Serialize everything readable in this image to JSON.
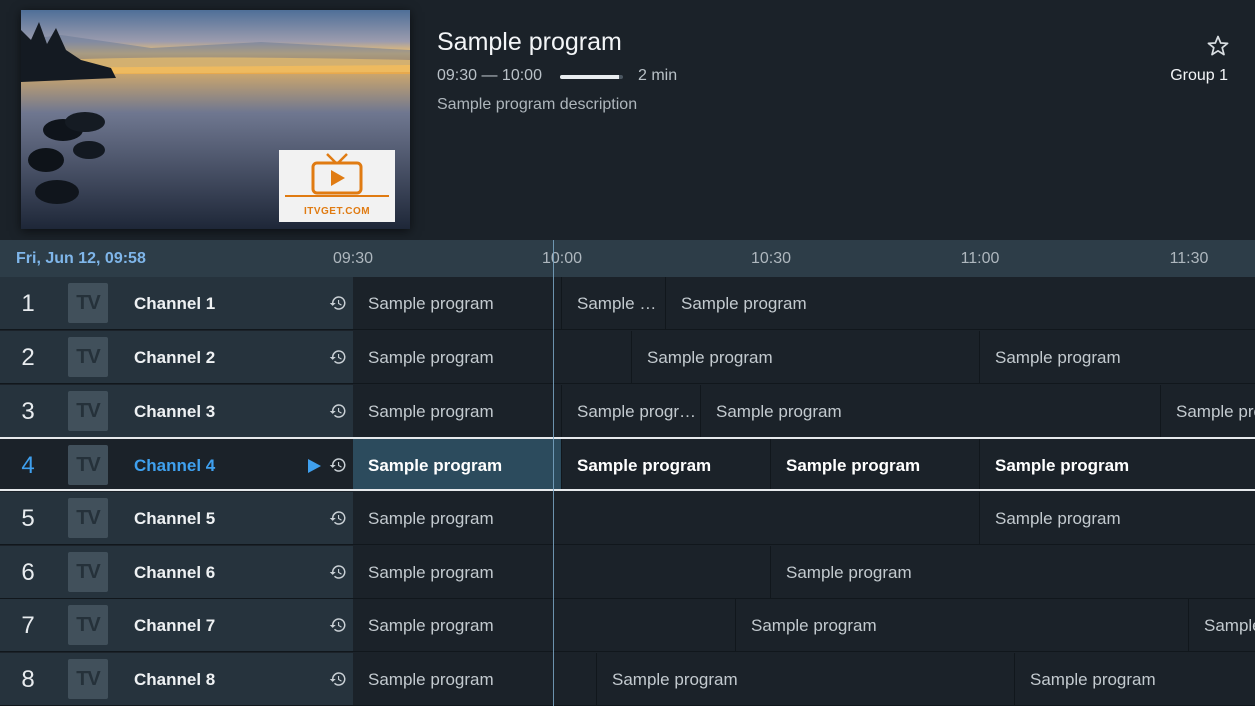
{
  "preview": {
    "logo_text": "ITVGET.COM",
    "logo_color": "#e07b12"
  },
  "program": {
    "title": "Sample program",
    "time": "09:30 — 10:00",
    "progress_fraction": 0.93,
    "remaining": "2 min",
    "description": "Sample program description"
  },
  "header": {
    "favorite_icon": "star-outline-icon",
    "group": "Group 1"
  },
  "timeline": {
    "current": "Fri, Jun 12, 09:58",
    "ticks": [
      "09:30",
      "10:00",
      "10:30",
      "11:00",
      "11:30"
    ]
  },
  "colors": {
    "accent": "#3fa0ee",
    "date": "#7fb6ea"
  },
  "channels": [
    {
      "number": "1",
      "logo": "TV",
      "name": "Channel 1",
      "programs": [
        "Sample program",
        "Sample …",
        "Sample program"
      ]
    },
    {
      "number": "2",
      "logo": "TV",
      "name": "Channel 2",
      "programs": [
        "Sample program",
        "Sample program",
        "Sample program"
      ]
    },
    {
      "number": "3",
      "logo": "TV",
      "name": "Channel 3",
      "programs": [
        "Sample program",
        "Sample progr…",
        "Sample program",
        "Sample pro"
      ]
    },
    {
      "number": "4",
      "logo": "TV",
      "name": "Channel 4",
      "selected": true,
      "programs": [
        "Sample program",
        "Sample program",
        "Sample program",
        "Sample program"
      ]
    },
    {
      "number": "5",
      "logo": "TV",
      "name": "Channel 5",
      "programs": [
        "Sample program",
        "Sample program"
      ]
    },
    {
      "number": "6",
      "logo": "TV",
      "name": "Channel 6",
      "programs": [
        "Sample program",
        "Sample program"
      ]
    },
    {
      "number": "7",
      "logo": "TV",
      "name": "Channel 7",
      "programs": [
        "Sample program",
        "Sample program",
        "Sample"
      ]
    },
    {
      "number": "8",
      "logo": "TV",
      "name": "Channel 8",
      "programs": [
        "Sample program",
        "Sample program",
        "Sample program"
      ]
    }
  ]
}
